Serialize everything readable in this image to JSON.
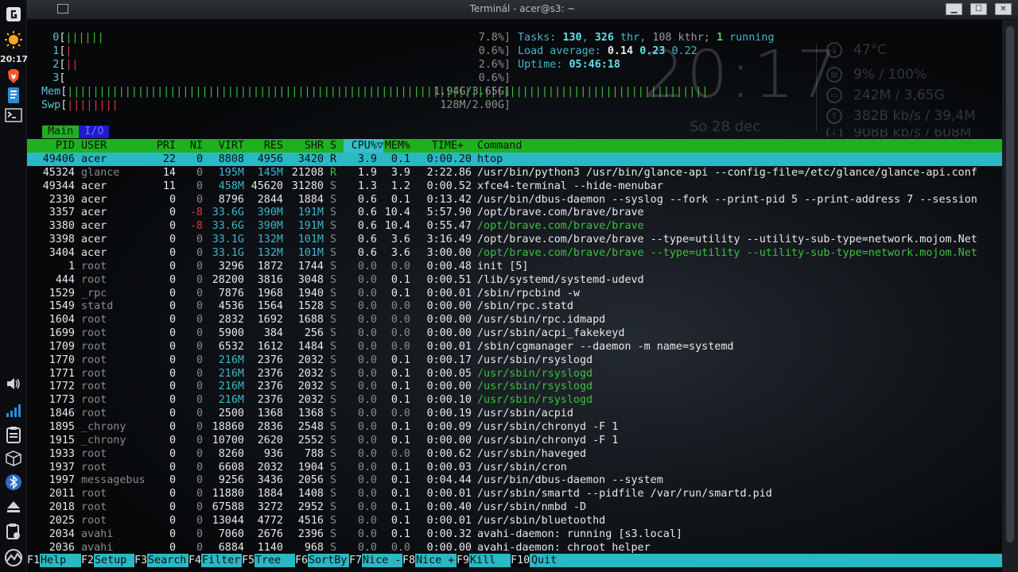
{
  "window": {
    "title": "Terminál - acer@s3: ~"
  },
  "panel": {
    "clock": "20:17"
  },
  "meters": {
    "cpus": [
      {
        "label": "0",
        "bars": "||||||",
        "value": "7.8%]"
      },
      {
        "label": "1",
        "bars": "|",
        "value": "0.6%]"
      },
      {
        "label": "2",
        "bars": "||",
        "value": "2.6%]"
      },
      {
        "label": "3",
        "bars": "",
        "value": "0.6%]"
      }
    ],
    "mem": {
      "label": "Mem",
      "bars": "||||||||||||||||||||||||||||||||||||||||||||||||||||||||||||||||||||||||||||||||||||||||||||||||||||",
      "value": "1.94G/3.65G]"
    },
    "swp": {
      "label": "Swp",
      "bars": "||||||||",
      "value": "128M/2.00G]"
    }
  },
  "info": {
    "tasks_label": "Tasks:",
    "tasks": "130",
    "thr": "326",
    "thr_label": "thr,",
    "kthr": "108 kthr;",
    "running": "1",
    "running_label": "running",
    "load_label": "Load average:",
    "load1": "0.14",
    "load5": "0.23",
    "load15": "0.22",
    "uptime_label": "Uptime:",
    "uptime": "05:46:18"
  },
  "widget": {
    "time": "20:17",
    "date": "So 28 dec",
    "temp": "47°C",
    "cpu": "9% / 100%",
    "mem": "242M / 3,65G",
    "net_up": "382B kb/s / 39,4M",
    "net_down": "908B kb/s / 608M"
  },
  "tabs": {
    "main": "Main",
    "io": "I/O"
  },
  "header": {
    "pid": "PID",
    "user": "USER",
    "pri": "PRI",
    "ni": "NI",
    "virt": "VIRT",
    "res": "RES",
    "shr": "SHR",
    "s": "S",
    "cpu": "CPU%▽",
    "mem": "MEM%",
    "time": "TIME+",
    "cmd": "Command"
  },
  "processes": [
    {
      "pid": "49406",
      "user": "acer",
      "pri": "22",
      "ni": "0",
      "virt": "8808",
      "res": "4956",
      "shr": "3420",
      "s": "R",
      "cpu": "3.9",
      "mem": "0.1",
      "time": "0:00.20",
      "cmd": "htop"
    },
    {
      "pid": "45324",
      "user": "glance",
      "pri": "14",
      "ni": "0",
      "virt": "195M",
      "res": "145M",
      "shr": "21208",
      "s": "R",
      "cpu": "1.9",
      "mem": "3.9",
      "time": "2:22.86",
      "cmd": "/usr/bin/python3 /usr/bin/glance-api --config-file=/etc/glance/glance-api.conf"
    },
    {
      "pid": "49344",
      "user": "acer",
      "pri": "11",
      "ni": "0",
      "virt": "458M",
      "res": "45620",
      "shr": "31280",
      "s": "S",
      "cpu": "1.3",
      "mem": "1.2",
      "time": "0:00.52",
      "cmd": "xfce4-terminal --hide-menubar"
    },
    {
      "pid": "2330",
      "user": "acer",
      "pri": "0",
      "ni": "0",
      "virt": "8796",
      "res": "2844",
      "shr": "1884",
      "s": "S",
      "cpu": "0.6",
      "mem": "0.1",
      "time": "0:13.42",
      "cmd": "/usr/bin/dbus-daemon --syslog --fork --print-pid 5 --print-address 7 --session"
    },
    {
      "pid": "3357",
      "user": "acer",
      "pri": "0",
      "ni": "-8",
      "virt": "33.6G",
      "res": "390M",
      "shr": "191M",
      "s": "S",
      "cpu": "0.6",
      "mem": "10.4",
      "time": "5:57.90",
      "cmd": "/opt/brave.com/brave/brave"
    },
    {
      "pid": "3380",
      "user": "acer",
      "pri": "0",
      "ni": "-8",
      "virt": "33.6G",
      "res": "390M",
      "shr": "191M",
      "s": "S",
      "cpu": "0.6",
      "mem": "10.4",
      "time": "0:55.47",
      "cmd": "/opt/brave.com/brave/brave"
    },
    {
      "pid": "3398",
      "user": "acer",
      "pri": "0",
      "ni": "0",
      "virt": "33.1G",
      "res": "132M",
      "shr": "101M",
      "s": "S",
      "cpu": "0.6",
      "mem": "3.6",
      "time": "3:16.49",
      "cmd": "/opt/brave.com/brave/brave --type=utility --utility-sub-type=network.mojom.Net"
    },
    {
      "pid": "3404",
      "user": "acer",
      "pri": "0",
      "ni": "0",
      "virt": "33.1G",
      "res": "132M",
      "shr": "101M",
      "s": "S",
      "cpu": "0.6",
      "mem": "3.6",
      "time": "3:00.00",
      "cmd": "/opt/brave.com/brave/brave --type=utility --utility-sub-type=network.mojom.Net"
    },
    {
      "pid": "1",
      "user": "root",
      "pri": "0",
      "ni": "0",
      "virt": "3296",
      "res": "1872",
      "shr": "1744",
      "s": "S",
      "cpu": "0.0",
      "mem": "0.0",
      "time": "0:00.48",
      "cmd": "init [5]"
    },
    {
      "pid": "444",
      "user": "root",
      "pri": "0",
      "ni": "0",
      "virt": "28200",
      "res": "3816",
      "shr": "3048",
      "s": "S",
      "cpu": "0.0",
      "mem": "0.1",
      "time": "0:00.51",
      "cmd": "/lib/systemd/systemd-udevd"
    },
    {
      "pid": "1529",
      "user": "_rpc",
      "pri": "0",
      "ni": "0",
      "virt": "7876",
      "res": "1968",
      "shr": "1940",
      "s": "S",
      "cpu": "0.0",
      "mem": "0.1",
      "time": "0:00.01",
      "cmd": "/sbin/rpcbind -w"
    },
    {
      "pid": "1549",
      "user": "statd",
      "pri": "0",
      "ni": "0",
      "virt": "4536",
      "res": "1564",
      "shr": "1528",
      "s": "S",
      "cpu": "0.0",
      "mem": "0.0",
      "time": "0:00.00",
      "cmd": "/sbin/rpc.statd"
    },
    {
      "pid": "1604",
      "user": "root",
      "pri": "0",
      "ni": "0",
      "virt": "2832",
      "res": "1692",
      "shr": "1688",
      "s": "S",
      "cpu": "0.0",
      "mem": "0.0",
      "time": "0:00.00",
      "cmd": "/usr/sbin/rpc.idmapd"
    },
    {
      "pid": "1699",
      "user": "root",
      "pri": "0",
      "ni": "0",
      "virt": "5900",
      "res": "384",
      "shr": "256",
      "s": "S",
      "cpu": "0.0",
      "mem": "0.0",
      "time": "0:00.00",
      "cmd": "/usr/sbin/acpi_fakekeyd"
    },
    {
      "pid": "1709",
      "user": "root",
      "pri": "0",
      "ni": "0",
      "virt": "6532",
      "res": "1612",
      "shr": "1484",
      "s": "S",
      "cpu": "0.0",
      "mem": "0.0",
      "time": "0:00.01",
      "cmd": "/sbin/cgmanager --daemon -m name=systemd"
    },
    {
      "pid": "1770",
      "user": "root",
      "pri": "0",
      "ni": "0",
      "virt": "216M",
      "res": "2376",
      "shr": "2032",
      "s": "S",
      "cpu": "0.0",
      "mem": "0.1",
      "time": "0:00.17",
      "cmd": "/usr/sbin/rsyslogd"
    },
    {
      "pid": "1771",
      "user": "root",
      "pri": "0",
      "ni": "0",
      "virt": "216M",
      "res": "2376",
      "shr": "2032",
      "s": "S",
      "cpu": "0.0",
      "mem": "0.1",
      "time": "0:00.05",
      "cmd": "/usr/sbin/rsyslogd"
    },
    {
      "pid": "1772",
      "user": "root",
      "pri": "0",
      "ni": "0",
      "virt": "216M",
      "res": "2376",
      "shr": "2032",
      "s": "S",
      "cpu": "0.0",
      "mem": "0.1",
      "time": "0:00.00",
      "cmd": "/usr/sbin/rsyslogd"
    },
    {
      "pid": "1773",
      "user": "root",
      "pri": "0",
      "ni": "0",
      "virt": "216M",
      "res": "2376",
      "shr": "2032",
      "s": "S",
      "cpu": "0.0",
      "mem": "0.1",
      "time": "0:00.10",
      "cmd": "/usr/sbin/rsyslogd"
    },
    {
      "pid": "1846",
      "user": "root",
      "pri": "0",
      "ni": "0",
      "virt": "2500",
      "res": "1368",
      "shr": "1368",
      "s": "S",
      "cpu": "0.0",
      "mem": "0.0",
      "time": "0:00.19",
      "cmd": "/usr/sbin/acpid"
    },
    {
      "pid": "1895",
      "user": "_chrony",
      "pri": "0",
      "ni": "0",
      "virt": "18860",
      "res": "2836",
      "shr": "2548",
      "s": "S",
      "cpu": "0.0",
      "mem": "0.1",
      "time": "0:00.09",
      "cmd": "/usr/sbin/chronyd -F 1"
    },
    {
      "pid": "1915",
      "user": "_chrony",
      "pri": "0",
      "ni": "0",
      "virt": "10700",
      "res": "2620",
      "shr": "2552",
      "s": "S",
      "cpu": "0.0",
      "mem": "0.1",
      "time": "0:00.00",
      "cmd": "/usr/sbin/chronyd -F 1"
    },
    {
      "pid": "1933",
      "user": "root",
      "pri": "0",
      "ni": "0",
      "virt": "8260",
      "res": "936",
      "shr": "788",
      "s": "S",
      "cpu": "0.0",
      "mem": "0.0",
      "time": "0:00.62",
      "cmd": "/usr/sbin/haveged"
    },
    {
      "pid": "1937",
      "user": "root",
      "pri": "0",
      "ni": "0",
      "virt": "6608",
      "res": "2032",
      "shr": "1904",
      "s": "S",
      "cpu": "0.0",
      "mem": "0.1",
      "time": "0:00.03",
      "cmd": "/usr/sbin/cron"
    },
    {
      "pid": "1997",
      "user": "messagebus",
      "pri": "0",
      "ni": "0",
      "virt": "9256",
      "res": "3436",
      "shr": "2056",
      "s": "S",
      "cpu": "0.0",
      "mem": "0.1",
      "time": "0:04.44",
      "cmd": "/usr/bin/dbus-daemon --system"
    },
    {
      "pid": "2011",
      "user": "root",
      "pri": "0",
      "ni": "0",
      "virt": "11880",
      "res": "1884",
      "shr": "1408",
      "s": "S",
      "cpu": "0.0",
      "mem": "0.1",
      "time": "0:00.01",
      "cmd": "/usr/sbin/smartd --pidfile /var/run/smartd.pid"
    },
    {
      "pid": "2018",
      "user": "root",
      "pri": "0",
      "ni": "0",
      "virt": "67588",
      "res": "3272",
      "shr": "2952",
      "s": "S",
      "cpu": "0.0",
      "mem": "0.1",
      "time": "0:00.40",
      "cmd": "/usr/sbin/nmbd -D"
    },
    {
      "pid": "2025",
      "user": "root",
      "pri": "0",
      "ni": "0",
      "virt": "13044",
      "res": "4772",
      "shr": "4516",
      "s": "S",
      "cpu": "0.0",
      "mem": "0.1",
      "time": "0:00.01",
      "cmd": "/usr/sbin/bluetoothd"
    },
    {
      "pid": "2034",
      "user": "avahi",
      "pri": "0",
      "ni": "0",
      "virt": "7060",
      "res": "2676",
      "shr": "2396",
      "s": "S",
      "cpu": "0.0",
      "mem": "0.1",
      "time": "0:00.32",
      "cmd": "avahi-daemon: running [s3.local]"
    },
    {
      "pid": "2036",
      "user": "avahi",
      "pri": "0",
      "ni": "0",
      "virt": "6884",
      "res": "1140",
      "shr": "968",
      "s": "S",
      "cpu": "0.0",
      "mem": "0.0",
      "time": "0:00.00",
      "cmd": "avahi-daemon: chroot helper"
    }
  ],
  "fkeys": [
    {
      "key": "F1",
      "label": "Help"
    },
    {
      "key": "F2",
      "label": "Setup"
    },
    {
      "key": "F3",
      "label": "Search"
    },
    {
      "key": "F4",
      "label": "Filter"
    },
    {
      "key": "F5",
      "label": "Tree"
    },
    {
      "key": "F6",
      "label": "SortBy"
    },
    {
      "key": "F7",
      "label": "Nice -"
    },
    {
      "key": "F8",
      "label": "Nice +"
    },
    {
      "key": "F9",
      "label": "Kill"
    },
    {
      "key": "F10",
      "label": "Quit"
    }
  ]
}
